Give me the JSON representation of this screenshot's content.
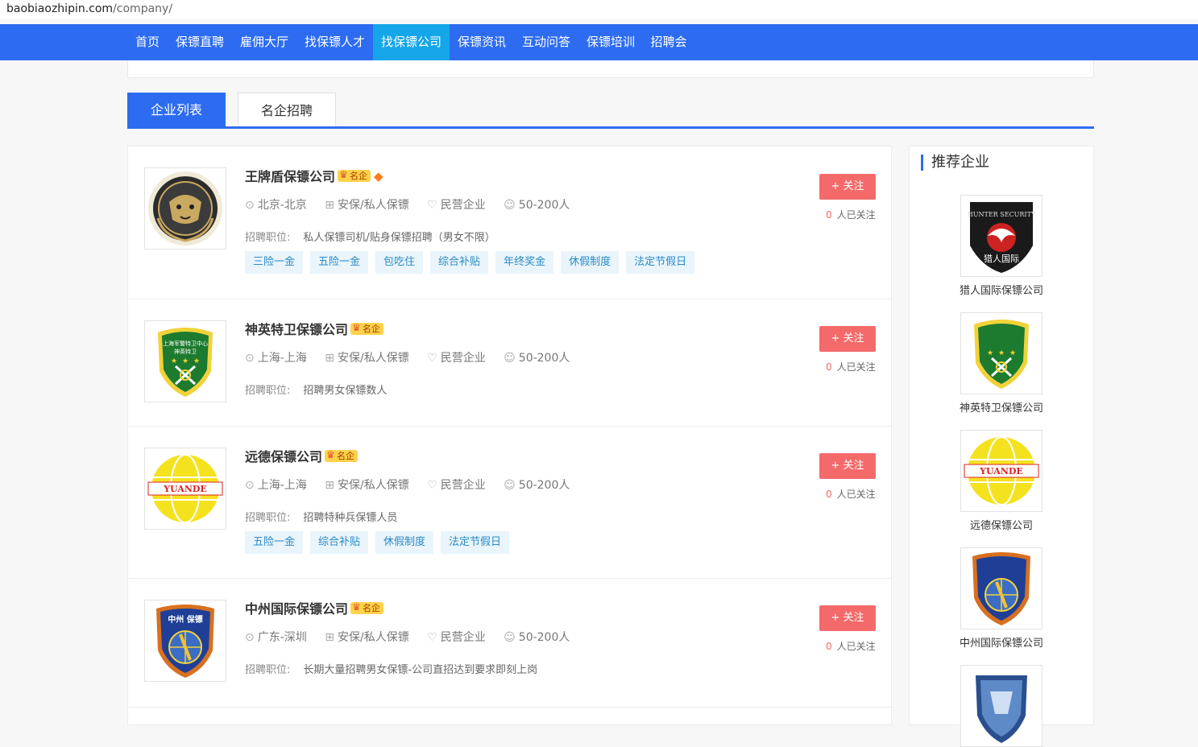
{
  "browser": {
    "url_domain": "baobiaozhipin.com",
    "url_path": "/company/"
  },
  "nav": {
    "items": [
      "首页",
      "保镖直聘",
      "雇佣大厅",
      "找保镖人才",
      "找保镖公司",
      "保镖资讯",
      "互动问答",
      "保镖培训",
      "招聘会"
    ],
    "active_index": 4
  },
  "tabs": [
    "企业列表",
    "名企招聘"
  ],
  "colors": {
    "primary": "#2d6cf0",
    "nav_active": "#14a6e8",
    "follow": "#f46a6a",
    "tag_bg": "#e9f4fb",
    "tag_text": "#2a8bc8"
  },
  "companies": [
    {
      "name": "王牌盾保镖公司",
      "badge": "名企",
      "diamond": true,
      "location": "北京-北京",
      "industry": "安保/私人保镖",
      "type": "民营企业",
      "size": "50-200人",
      "jobs_label": "招聘职位:",
      "jobs": "私人保镖司机/贴身保镖招聘（男女不限）",
      "tags": [
        "三险一金",
        "五险一金",
        "包吃住",
        "综合补贴",
        "年终奖金",
        "休假制度",
        "法定节假日"
      ],
      "follow_label": "+ 关注",
      "followers": "0",
      "followers_suffix": "人已关注",
      "logo_icon": "tiger-emblem-logo"
    },
    {
      "name": "神英特卫保镖公司",
      "badge": "名企",
      "diamond": false,
      "location": "上海-上海",
      "industry": "安保/私人保镖",
      "type": "民营企业",
      "size": "50-200人",
      "jobs_label": "招聘职位:",
      "jobs": "招聘男女保镖数人",
      "tags": [],
      "follow_label": "+ 关注",
      "followers": "0",
      "followers_suffix": "人已关注",
      "logo_icon": "green-shield-logo"
    },
    {
      "name": "远德保镖公司",
      "badge": "名企",
      "diamond": false,
      "location": "上海-上海",
      "industry": "安保/私人保镖",
      "type": "民营企业",
      "size": "50-200人",
      "jobs_label": "招聘职位:",
      "jobs": "招聘特种兵保镖人员",
      "tags": [
        "五险一金",
        "综合补贴",
        "休假制度",
        "法定节假日"
      ],
      "follow_label": "+ 关注",
      "followers": "0",
      "followers_suffix": "人已关注",
      "logo_icon": "yuande-globe-logo"
    },
    {
      "name": "中州国际保镖公司",
      "badge": "名企",
      "diamond": false,
      "location": "广东-深圳",
      "industry": "安保/私人保镖",
      "type": "民营企业",
      "size": "50-200人",
      "jobs_label": "招聘职位:",
      "jobs": "长期大量招聘男女保镖-公司直招达到要求即刻上岗",
      "tags": [],
      "follow_label": "+ 关注",
      "followers": "0",
      "followers_suffix": "人已关注",
      "logo_icon": "blue-shield-logo"
    }
  ],
  "sidebar": {
    "title": "推荐企业",
    "items": [
      {
        "name": "猎人国际保镖公司",
        "logo_icon": "hunter-security-logo"
      },
      {
        "name": "神英特卫保镖公司",
        "logo_icon": "green-shield-logo"
      },
      {
        "name": "远德保镖公司",
        "logo_icon": "yuande-globe-logo"
      },
      {
        "name": "中州国际保镖公司",
        "logo_icon": "blue-shield-logo"
      },
      {
        "name": "",
        "logo_icon": "blue-badge-logo"
      }
    ]
  }
}
